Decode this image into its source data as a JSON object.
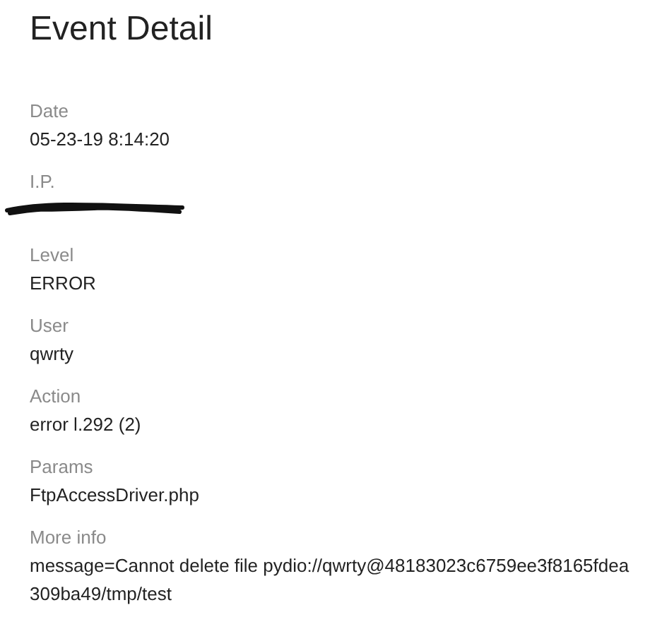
{
  "title": "Event Detail",
  "fields": [
    {
      "label": "Date",
      "value": "05-23-19 8:14:20",
      "kind": "text"
    },
    {
      "label": "I.P.",
      "kind": "redacted"
    },
    {
      "label": "Level",
      "value": "ERROR",
      "kind": "text"
    },
    {
      "label": "User",
      "value": "qwrty",
      "kind": "text"
    },
    {
      "label": "Action",
      "value": "error l.292 (2)",
      "kind": "text"
    },
    {
      "label": "Params",
      "value": "FtpAccessDriver.php",
      "kind": "text"
    },
    {
      "label": "More info",
      "value": "message=Cannot delete file pydio://qwrty@48183023c6759ee3f8165fdea309ba49/tmp/test",
      "kind": "text"
    }
  ]
}
